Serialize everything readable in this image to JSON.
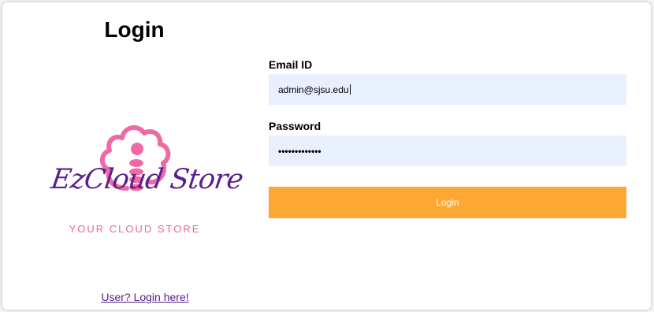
{
  "page": {
    "title": "Login"
  },
  "brand": {
    "name": "EzCloud Store",
    "tagline": "YOUR CLOUD STORE",
    "colors": {
      "cloud_pink": "#ef6aa5",
      "name_purple": "#5b1f8a",
      "tagline_pink": "#e8659f"
    }
  },
  "form": {
    "email_label": "Email ID",
    "email_value": "admin@sjsu.edu",
    "password_label": "Password",
    "password_value": "•••••••••••••",
    "submit_label": "Login",
    "input_bg": "#e8f0fe",
    "button_color": "#ffa733"
  },
  "links": {
    "user_login": "User? Login here!"
  }
}
